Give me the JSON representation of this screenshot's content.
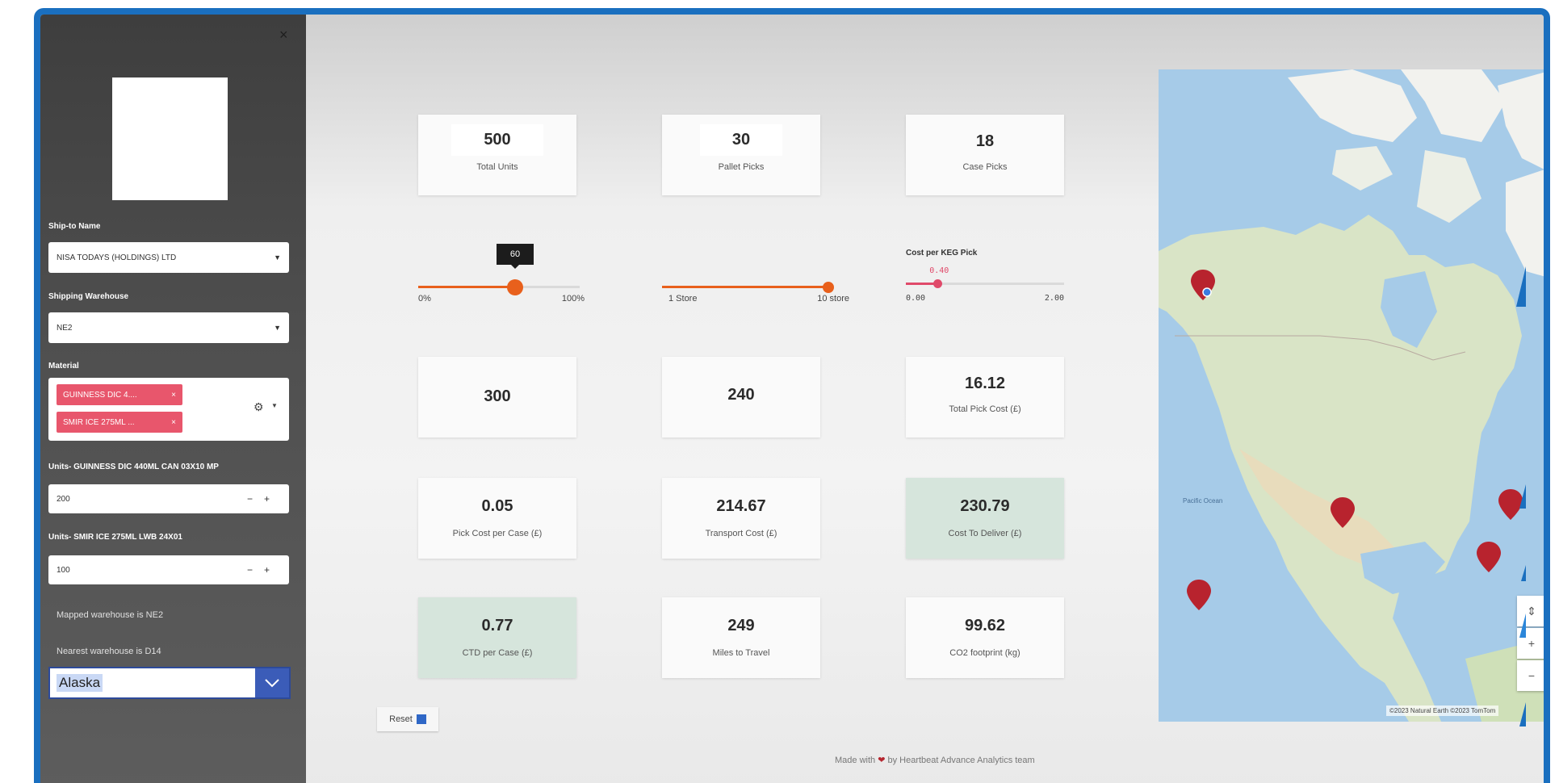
{
  "sidebar": {
    "close_label": "×",
    "ship_to": {
      "label": "Ship-to Name",
      "value": "NISA TODAYS (HOLDINGS) LTD"
    },
    "warehouse": {
      "label": "Shipping Warehouse",
      "value": "NE2"
    },
    "material": {
      "label": "Material",
      "tags": [
        "GUINNESS DIC 4....",
        "SMIR ICE 275ML ..."
      ],
      "tag_remove": "×"
    },
    "units_guinness": {
      "label": "Units- GUINNESS DIC 440ML CAN 03X10 MP",
      "value": "200"
    },
    "units_smir": {
      "label": "Units- SMIR ICE 275ML LWB 24X01",
      "value": "100"
    },
    "mapped_text": "Mapped warehouse is NE2",
    "nearest_text": "Nearest warehouse is D14",
    "region": {
      "value": "Alaska"
    }
  },
  "cards": {
    "total_units": {
      "value": "500",
      "label": "Total Units"
    },
    "pallet_picks": {
      "value": "30",
      "label": "Pallet Picks"
    },
    "case_picks": {
      "value": "18",
      "label": "Case Picks"
    },
    "c300": {
      "value": "300"
    },
    "c240": {
      "value": "240"
    },
    "total_pick_cost": {
      "value": "16.12",
      "label": "Total Pick Cost (£)"
    },
    "pick_cost_case": {
      "value": "0.05",
      "label": "Pick Cost per Case (£)"
    },
    "transport_cost": {
      "value": "214.67",
      "label": "Transport Cost (£)"
    },
    "cost_to_deliver": {
      "value": "230.79",
      "label": "Cost To Deliver (£)"
    },
    "ctd_case": {
      "value": "0.77",
      "label": "CTD per Case (£)"
    },
    "miles": {
      "value": "249",
      "label": "Miles to Travel"
    },
    "co2": {
      "value": "99.62",
      "label": "CO2 footprint (kg)"
    }
  },
  "sliders": {
    "percent": {
      "value": 60,
      "min": 0,
      "max": 100,
      "tooltip": "60",
      "min_label": "0%",
      "max_label": "100%",
      "color": "#e8601c"
    },
    "stores": {
      "value": 10,
      "min": 1,
      "max": 10,
      "min_label": "1 Store",
      "max_label": "10 store",
      "color": "#e8601c"
    },
    "keg": {
      "title": "Cost per KEG Pick",
      "value": 0.4,
      "min": 0,
      "max": 2,
      "value_label": "0.40",
      "min_label": "0.00",
      "max_label": "2.00",
      "color": "#e04a6a"
    }
  },
  "reset_label": "Reset",
  "footer": {
    "prefix": "Made with",
    "suffix": "by Heartbeat Advance Analytics team"
  },
  "map": {
    "ocean_label": "Pacific Ocean",
    "attribution": "©2023 Natural Earth ©2023 TomTom",
    "zoom_reset": "⇕",
    "zoom_in": "+",
    "zoom_out": "−"
  }
}
